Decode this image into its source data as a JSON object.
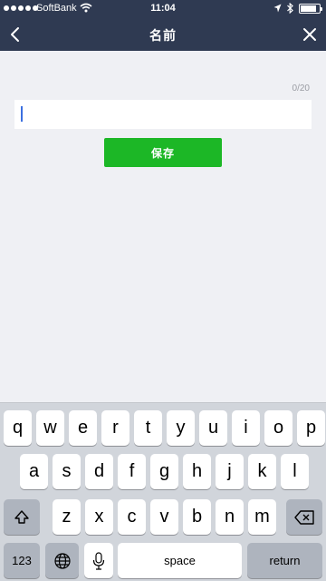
{
  "status_bar": {
    "carrier": "SoftBank",
    "time": "11:04",
    "battery_level": 0.85
  },
  "nav": {
    "title": "名前",
    "back_icon": "chevron-left-icon",
    "close_icon": "close-icon"
  },
  "form": {
    "char_count": "0/20",
    "input_value": "",
    "save_label": "保存"
  },
  "colors": {
    "header_bg": "#2f3a52",
    "save_button": "#1cb726",
    "page_bg": "#eff0f4",
    "caret": "#3b6fe0"
  },
  "keyboard": {
    "row1": [
      "q",
      "w",
      "e",
      "r",
      "t",
      "y",
      "u",
      "i",
      "o",
      "p"
    ],
    "row2": [
      "a",
      "s",
      "d",
      "f",
      "g",
      "h",
      "j",
      "k",
      "l"
    ],
    "row3": [
      "z",
      "x",
      "c",
      "v",
      "b",
      "n",
      "m"
    ],
    "numbers_label": "123",
    "space_label": "space",
    "return_label": "return",
    "icons": [
      "shift-icon",
      "backspace-icon",
      "globe-icon",
      "microphone-icon"
    ]
  }
}
